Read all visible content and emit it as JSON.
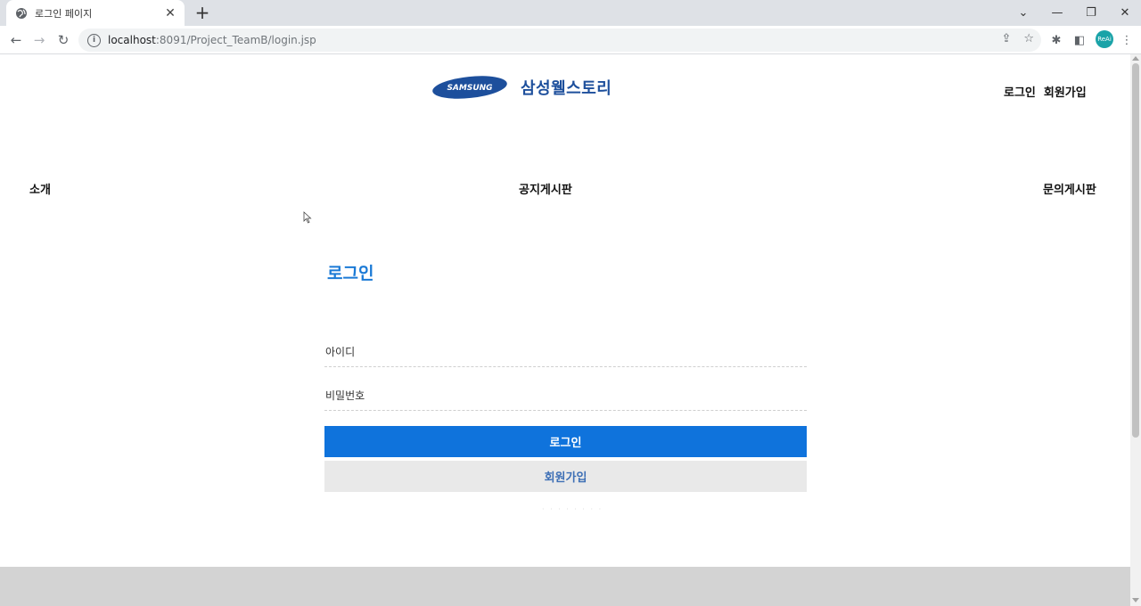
{
  "browser": {
    "tab_title": "로그인 페이지",
    "url_host": "localhost",
    "url_path": ":8091/Project_TeamB/login.jsp",
    "avatar_text": "ReAi"
  },
  "header": {
    "logo_brand": "SAMSUNG",
    "logo_text": "삼성웰스토리",
    "links": {
      "login": "로그인",
      "signup": "회원가입"
    }
  },
  "menu": {
    "intro": "소개",
    "notice": "공지게시판",
    "inquiry": "문의게시판"
  },
  "login": {
    "title": "로그인",
    "id_placeholder": "아이디",
    "password_placeholder": "비밀번호",
    "login_button": "로그인",
    "signup_button": "회원가입"
  },
  "colors": {
    "accent": "#0f73dc",
    "title": "#1b7ad6",
    "brand_blue": "#1d4f9c"
  }
}
